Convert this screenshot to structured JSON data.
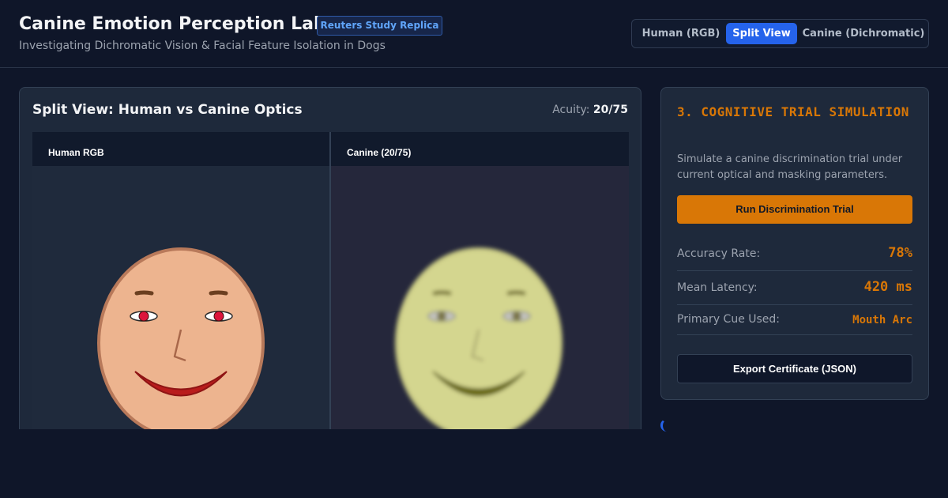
{
  "header": {
    "title": "Canine Emotion Perception Lab",
    "badge": "Reuters Study Replica",
    "subtitle": "Investigating Dichromatic Vision & Facial Feature Isolation in Dogs"
  },
  "view_toggle": {
    "options": [
      "Human (RGB)",
      "Split View",
      "Canine (Dichromatic)"
    ],
    "selected": "Split View"
  },
  "viewer": {
    "title": "Split View: Human vs Canine Optics",
    "acuity_label": "Acuity:",
    "acuity_value": "20/75",
    "human_label": "Human RGB",
    "canine_label": "Canine (20/75)"
  },
  "trial": {
    "heading": "3. COGNITIVE TRIAL SIMULATION",
    "description": "Simulate a canine discrimination trial under current optical and masking parameters.",
    "run_label": "Run Discrimination Trial",
    "stats": [
      {
        "label": "Accuracy Rate:",
        "value": "78%"
      },
      {
        "label": "Mean Latency:",
        "value": "420 ms"
      },
      {
        "label": "Primary Cue Used:",
        "value": "Mouth Arc"
      }
    ],
    "export_label": "Export Certificate (JSON)"
  },
  "colors": {
    "accent_blue": "#2563eb",
    "accent_orange": "#d97706",
    "human_skin": "#edb48f",
    "human_mouth": "#b91c1c",
    "canine_skin": "#d4d68f",
    "canine_mouth": "#6b6a10"
  }
}
